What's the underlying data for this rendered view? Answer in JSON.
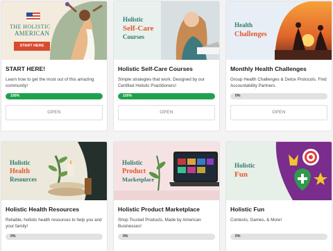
{
  "cards": [
    {
      "title": "START HERE!",
      "description": "Learn how to get the most out of this amazing community!",
      "progress": 100,
      "progress_label": "100%",
      "open_label": "OPEN",
      "thumb": {
        "brand_line1": "THE HOLISTIC",
        "brand_line2": "AMERICAN",
        "cta": "START HERE"
      }
    },
    {
      "title": "Holistic Self-Care Courses",
      "description": "Simple strategies that work. Designed by our Certified Holistic Practitioners!",
      "progress": 100,
      "progress_label": "100%",
      "open_label": "OPEN",
      "thumb": {
        "line1": "Holistic",
        "line2": "Self-Care",
        "line3": "Courses"
      }
    },
    {
      "title": "Monthly Health Challenges",
      "description": "Group Health Challenges & Detox Protocols. Find Accountability Partners.",
      "progress": 0,
      "progress_label": "0%",
      "open_label": "OPEN",
      "thumb": {
        "line1": "Health",
        "line2": "Challenges"
      }
    },
    {
      "title": "Holistic Health Resources",
      "description": "Reliable, holistic health resources to help you and your family!",
      "progress": 0,
      "progress_label": "0%",
      "thumb": {
        "line1": "Holistic",
        "line2": "Health",
        "line3": "Resources"
      }
    },
    {
      "title": "Holistic Product Marketplace",
      "description": "Shop Trusted Products, Made by American Businesses!",
      "progress": 0,
      "progress_label": "0%",
      "thumb": {
        "line1": "Holistic",
        "line2": "Product",
        "line3": "Marketplace"
      }
    },
    {
      "title": "Holistic Fun",
      "description": "Contests, Games, & More!",
      "progress": 0,
      "progress_label": "0%",
      "thumb": {
        "line1": "Holistic",
        "line2": "Fun"
      }
    }
  ],
  "colors": {
    "progress_fill": "#1fa24f",
    "progress_track": "#e2e2e2",
    "accent_orange": "#e4572e",
    "brand_teal": "#2f7a6b",
    "brand_red": "#d94a2e"
  }
}
